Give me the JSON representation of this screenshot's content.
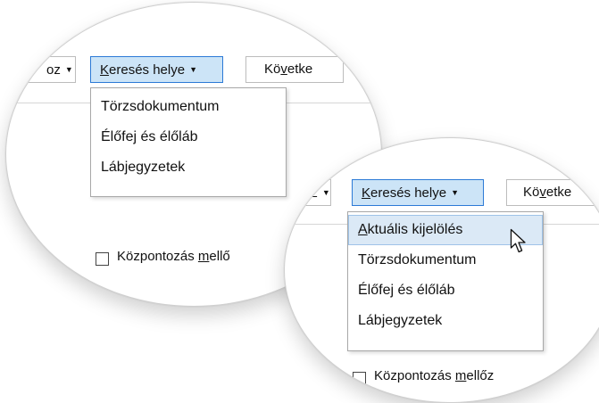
{
  "first_view": {
    "partial_button_label": "oz",
    "search_in_button": {
      "label_accel": "K",
      "label_rest": "eresés helye"
    },
    "next_button": {
      "label_start": "Kö",
      "label_accel": "v",
      "label_rest": "etke"
    },
    "menu_items": [
      "Törzsdokumentum",
      "Élőfej és élőláb",
      "Lábjegyzetek"
    ],
    "checkbox": {
      "label_start": "Központozás ",
      "label_accel": "m",
      "label_rest": "ellő"
    }
  },
  "second_view": {
    "partial_button_label": "oz",
    "search_in_button": {
      "label_accel": "K",
      "label_rest": "eresés helye"
    },
    "next_button": {
      "label_start": "Kö",
      "label_accel": "v",
      "label_rest": "etke"
    },
    "highlighted_item": {
      "label_accel": "A",
      "label_rest": "ktuális kijelölés"
    },
    "menu_items": [
      "Törzsdokumentum",
      "Élőfej és élőláb",
      "Lábjegyzetek"
    ],
    "checkbox": {
      "label_start": "Központozás ",
      "label_accel": "m",
      "label_rest": "ellőz"
    }
  },
  "icons": {
    "dropdown_caret": "caret-down-icon",
    "pointer": "mouse-pointer-icon"
  },
  "colors": {
    "active_button_bg": "#cce4f7",
    "active_button_border": "#2c7ad6",
    "highlight_bg": "#dbe9f6"
  }
}
